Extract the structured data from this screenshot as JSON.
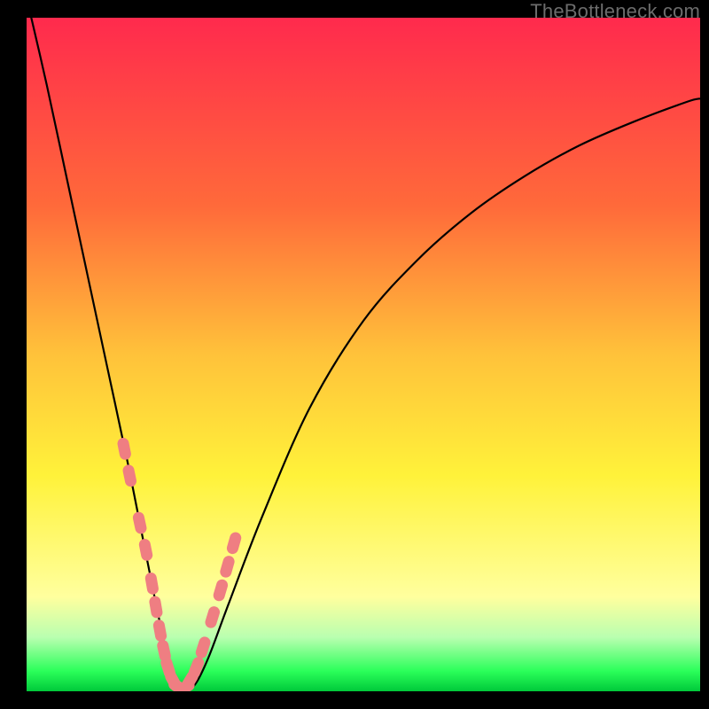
{
  "watermark": "TheBottleneck.com",
  "colors": {
    "gradient_top": "#ff2a4d",
    "gradient_mid_upper": "#ff6a3a",
    "gradient_mid": "#ffc23a",
    "gradient_mid_lower": "#fff23a",
    "gradient_yellow_pale": "#ffff9e",
    "gradient_green_pale": "#b9ffb0",
    "gradient_green": "#2bff5a",
    "gradient_green_deep": "#00c93a",
    "curve": "#000000",
    "marker_fill": "#ef7e82",
    "marker_stroke": "#ef7e82",
    "frame": "#000000"
  },
  "chart_data": {
    "type": "line",
    "title": "",
    "xlabel": "",
    "ylabel": "",
    "xlim": [
      0,
      100
    ],
    "ylim": [
      0,
      100
    ],
    "grid": false,
    "series": [
      {
        "name": "bottleneck-curve",
        "x": [
          0,
          3,
          6,
          9,
          12,
          15,
          17,
          19,
          20.5,
          22,
          23.5,
          25,
          27,
          30,
          35,
          42,
          50,
          58,
          66,
          74,
          82,
          90,
          98,
          100
        ],
        "values": [
          103,
          90,
          76,
          62,
          48,
          34,
          24,
          14,
          7,
          2,
          0.5,
          1,
          5,
          13,
          26,
          42,
          55,
          64,
          71,
          76.5,
          81,
          84.5,
          87.5,
          88
        ]
      }
    ],
    "markers": {
      "name": "highlighted-points",
      "x": [
        14.5,
        15.3,
        16.8,
        17.7,
        18.6,
        19.2,
        19.8,
        20.4,
        21.0,
        21.8,
        22.6,
        23.4,
        24.2,
        25.2,
        26.2,
        27.6,
        28.8,
        29.8,
        30.8
      ],
      "values": [
        36,
        32,
        25,
        21,
        16,
        12.5,
        9,
        6,
        3.5,
        1.5,
        0.6,
        0.5,
        1.5,
        3.5,
        6.5,
        11,
        15,
        18.5,
        22
      ]
    }
  }
}
